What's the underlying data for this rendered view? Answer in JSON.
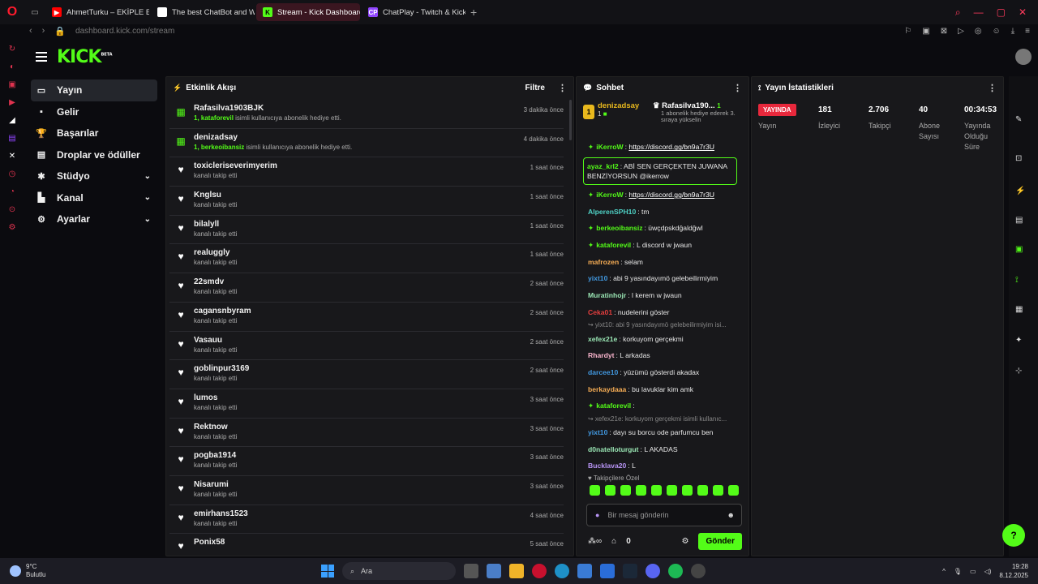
{
  "browser": {
    "tabs": [
      {
        "label": "AhmetTurku – EKİPLE ESK",
        "fav_color": "#ff0000",
        "fav_glyph": "▶"
      },
      {
        "label": "The best ChatBot and W",
        "fav_color": "#ffffff",
        "fav_glyph": "◆"
      },
      {
        "label": "Stream - Kick Dashboard",
        "fav_color": "#53fc18",
        "fav_glyph": "K"
      },
      {
        "label": "ChatPlay - Twitch & Kick",
        "fav_color": "#9146ff",
        "fav_glyph": "CP"
      }
    ],
    "url_host": "dashboard.kick.com",
    "url_path": "/stream"
  },
  "kick": {
    "logo": "KICK",
    "beta": "BETA"
  },
  "nav": [
    {
      "label": "Yayın",
      "icon": "camera-icon",
      "glyph": "▭",
      "active": true,
      "chevron": false
    },
    {
      "label": "Gelir",
      "icon": "wallet-icon",
      "glyph": "▪",
      "active": false,
      "chevron": false
    },
    {
      "label": "Başarılar",
      "icon": "trophy-icon",
      "glyph": "🏆",
      "active": false,
      "chevron": false
    },
    {
      "label": "Droplar ve ödüller",
      "icon": "gift-icon",
      "glyph": "▤",
      "active": false,
      "chevron": false
    },
    {
      "label": "Stüdyo",
      "icon": "studio-icon",
      "glyph": "✱",
      "active": false,
      "chevron": true
    },
    {
      "label": "Kanal",
      "icon": "channel-icon",
      "glyph": "▙",
      "active": false,
      "chevron": true
    },
    {
      "label": "Ayarlar",
      "icon": "settings-icon",
      "glyph": "⚙",
      "active": false,
      "chevron": true
    }
  ],
  "activity": {
    "title": "Etkinlik Akışı",
    "filter": "Filtre",
    "events": [
      {
        "name": "Rafasilva1903BJK",
        "sub_user": "1, kataforevil",
        "sub_text": " isimli kullanıcıya abonelik hediye etti.",
        "time": "3 dakika önce",
        "type": "gift"
      },
      {
        "name": "denizadsay",
        "sub_user": "1, berkeoibansiz",
        "sub_text": " isimli kullanıcıya abonelik hediye etti.",
        "time": "4 dakika önce",
        "type": "gift"
      },
      {
        "name": "toxicleriseverimyerim",
        "sub_user": "",
        "sub_text": "kanalı takip etti",
        "time": "1 saat önce",
        "type": "follow"
      },
      {
        "name": "Knglsu",
        "sub_user": "",
        "sub_text": "kanalı takip etti",
        "time": "1 saat önce",
        "type": "follow"
      },
      {
        "name": "bilalyll",
        "sub_user": "",
        "sub_text": "kanalı takip etti",
        "time": "1 saat önce",
        "type": "follow"
      },
      {
        "name": "realuggly",
        "sub_user": "",
        "sub_text": "kanalı takip etti",
        "time": "1 saat önce",
        "type": "follow"
      },
      {
        "name": "22smdv",
        "sub_user": "",
        "sub_text": "kanalı takip etti",
        "time": "2 saat önce",
        "type": "follow"
      },
      {
        "name": "cagansnbyram",
        "sub_user": "",
        "sub_text": "kanalı takip etti",
        "time": "2 saat önce",
        "type": "follow"
      },
      {
        "name": "Vasauu",
        "sub_user": "",
        "sub_text": "kanalı takip etti",
        "time": "2 saat önce",
        "type": "follow"
      },
      {
        "name": "goblinpur3169",
        "sub_user": "",
        "sub_text": "kanalı takip etti",
        "time": "2 saat önce",
        "type": "follow"
      },
      {
        "name": "lumos",
        "sub_user": "",
        "sub_text": "kanalı takip etti",
        "time": "3 saat önce",
        "type": "follow"
      },
      {
        "name": "Rektnow",
        "sub_user": "",
        "sub_text": "kanalı takip etti",
        "time": "3 saat önce",
        "type": "follow"
      },
      {
        "name": "pogba1914",
        "sub_user": "",
        "sub_text": "kanalı takip etti",
        "time": "3 saat önce",
        "type": "follow"
      },
      {
        "name": "Nisarumi",
        "sub_user": "",
        "sub_text": "kanalı takip etti",
        "time": "3 saat önce",
        "type": "follow"
      },
      {
        "name": "emirhans1523",
        "sub_user": "",
        "sub_text": "kanalı takip etti",
        "time": "4 saat önce",
        "type": "follow"
      },
      {
        "name": "Ponix58",
        "sub_user": "",
        "sub_text": "",
        "time": "5 saat önce",
        "type": "follow"
      }
    ]
  },
  "chat": {
    "title": "Sohbet",
    "pinned": [
      {
        "name": "denizadsay",
        "badge": "1",
        "count": "1"
      },
      {
        "name": "Rafasilva190...",
        "count": "1",
        "text": "1 abonelik hediye ederek 3. sıraya yükselin"
      }
    ],
    "messages": [
      {
        "user": "iKerroW",
        "color": "#53fc18",
        "text": "https://discord.gg/bn9a7r3U",
        "link": true,
        "boxed": false,
        "reply": false
      },
      {
        "user": "ayaz_krl2",
        "color": "#53fc18",
        "text": "ABİ SEN GERÇEKTEN JUWANA BENZİYORSUN @ikerrow",
        "link": false,
        "boxed": true,
        "reply": false
      },
      {
        "user": "iKerroW",
        "color": "#53fc18",
        "text": "https://discord.gg/bn9a7r3U",
        "link": true,
        "boxed": false,
        "reply": false
      },
      {
        "user": "AlperenSPH10",
        "color": "#4fd1c5",
        "text": "tm",
        "link": false,
        "boxed": false,
        "reply": false
      },
      {
        "user": "berkeoibansiz",
        "color": "#53fc18",
        "text": "üwçdpskdğaldğwl",
        "link": false,
        "boxed": false,
        "reply": false
      },
      {
        "user": "kataforevil",
        "color": "#53fc18",
        "text": "L discord w jwaun",
        "link": false,
        "boxed": false,
        "reply": false
      },
      {
        "user": "mafrozen",
        "color": "#f6ad55",
        "text": "selam",
        "link": false,
        "boxed": false,
        "reply": false
      },
      {
        "user": "yixt10",
        "color": "#4299e1",
        "text": "abi 9 yasındayımö gelebeilirmiyim",
        "link": false,
        "boxed": false,
        "reply": false
      },
      {
        "user": "Muratinhojr",
        "color": "#9ae6b4",
        "text": "l kerem w jwaun",
        "link": false,
        "boxed": false,
        "reply": false
      },
      {
        "user": "Ceka01",
        "color": "#e53e3e",
        "text": "nudelerini göster",
        "link": false,
        "boxed": false,
        "reply": false
      },
      {
        "user": "",
        "color": "#888888",
        "text": "↪ yixt10: abi 9 yasındayımö gelebeilirmiyim isi...",
        "link": false,
        "boxed": false,
        "reply": true
      },
      {
        "user": "xefex21e",
        "color": "#9ae6b4",
        "text": "korkuyom gerçekmi",
        "link": false,
        "boxed": false,
        "reply": false
      },
      {
        "user": "Rhardyt",
        "color": "#fbb6ce",
        "text": "L arkadas",
        "link": false,
        "boxed": false,
        "reply": false
      },
      {
        "user": "darcee10",
        "color": "#4299e1",
        "text": "yüzümü gösterdi akadax",
        "link": false,
        "boxed": false,
        "reply": false
      },
      {
        "user": "berkaydaaa",
        "color": "#f6ad55",
        "text": "bu lavuklar kim amk",
        "link": false,
        "boxed": false,
        "reply": false
      },
      {
        "user": "kataforevil",
        "color": "#53fc18",
        "text": "",
        "link": false,
        "boxed": false,
        "reply": false
      },
      {
        "user": "",
        "color": "#888888",
        "text": "↪ xefex21e: korkuyom gerçekmi isimli kullanıc...",
        "link": false,
        "boxed": false,
        "reply": true
      },
      {
        "user": "yixt10",
        "color": "#4299e1",
        "text": "dayı su borcu ode parfumcu ben",
        "link": false,
        "boxed": false,
        "reply": false
      },
      {
        "user": "d0natelloturgut",
        "color": "#9ae6b4",
        "text": "L AKADAS",
        "link": false,
        "boxed": false,
        "reply": false
      },
      {
        "user": "Bucklava20",
        "color": "#b794f4",
        "text": "L",
        "link": false,
        "boxed": false,
        "reply": false
      }
    ],
    "followers_only": "Takipçilere Özel",
    "input_placeholder": "Bir mesaj gönderin",
    "points": "0",
    "send": "Gönder"
  },
  "stats": {
    "title": "Yayın İstatistikleri",
    "items": [
      {
        "value": "YAYINDA",
        "label": "Yayın",
        "live": true
      },
      {
        "value": "181",
        "label": "İzleyici",
        "live": false
      },
      {
        "value": "2.706",
        "label": "Takipçi",
        "live": false
      },
      {
        "value": "40",
        "label": "Abone Sayısı",
        "live": false
      },
      {
        "value": "00:34:53",
        "label": "Yayında Olduğu Süre",
        "live": false
      }
    ]
  },
  "taskbar": {
    "temp": "9°C",
    "weather": "Bulutlu",
    "search": "Ara",
    "time": "19:28",
    "date": "8.12.2025"
  }
}
